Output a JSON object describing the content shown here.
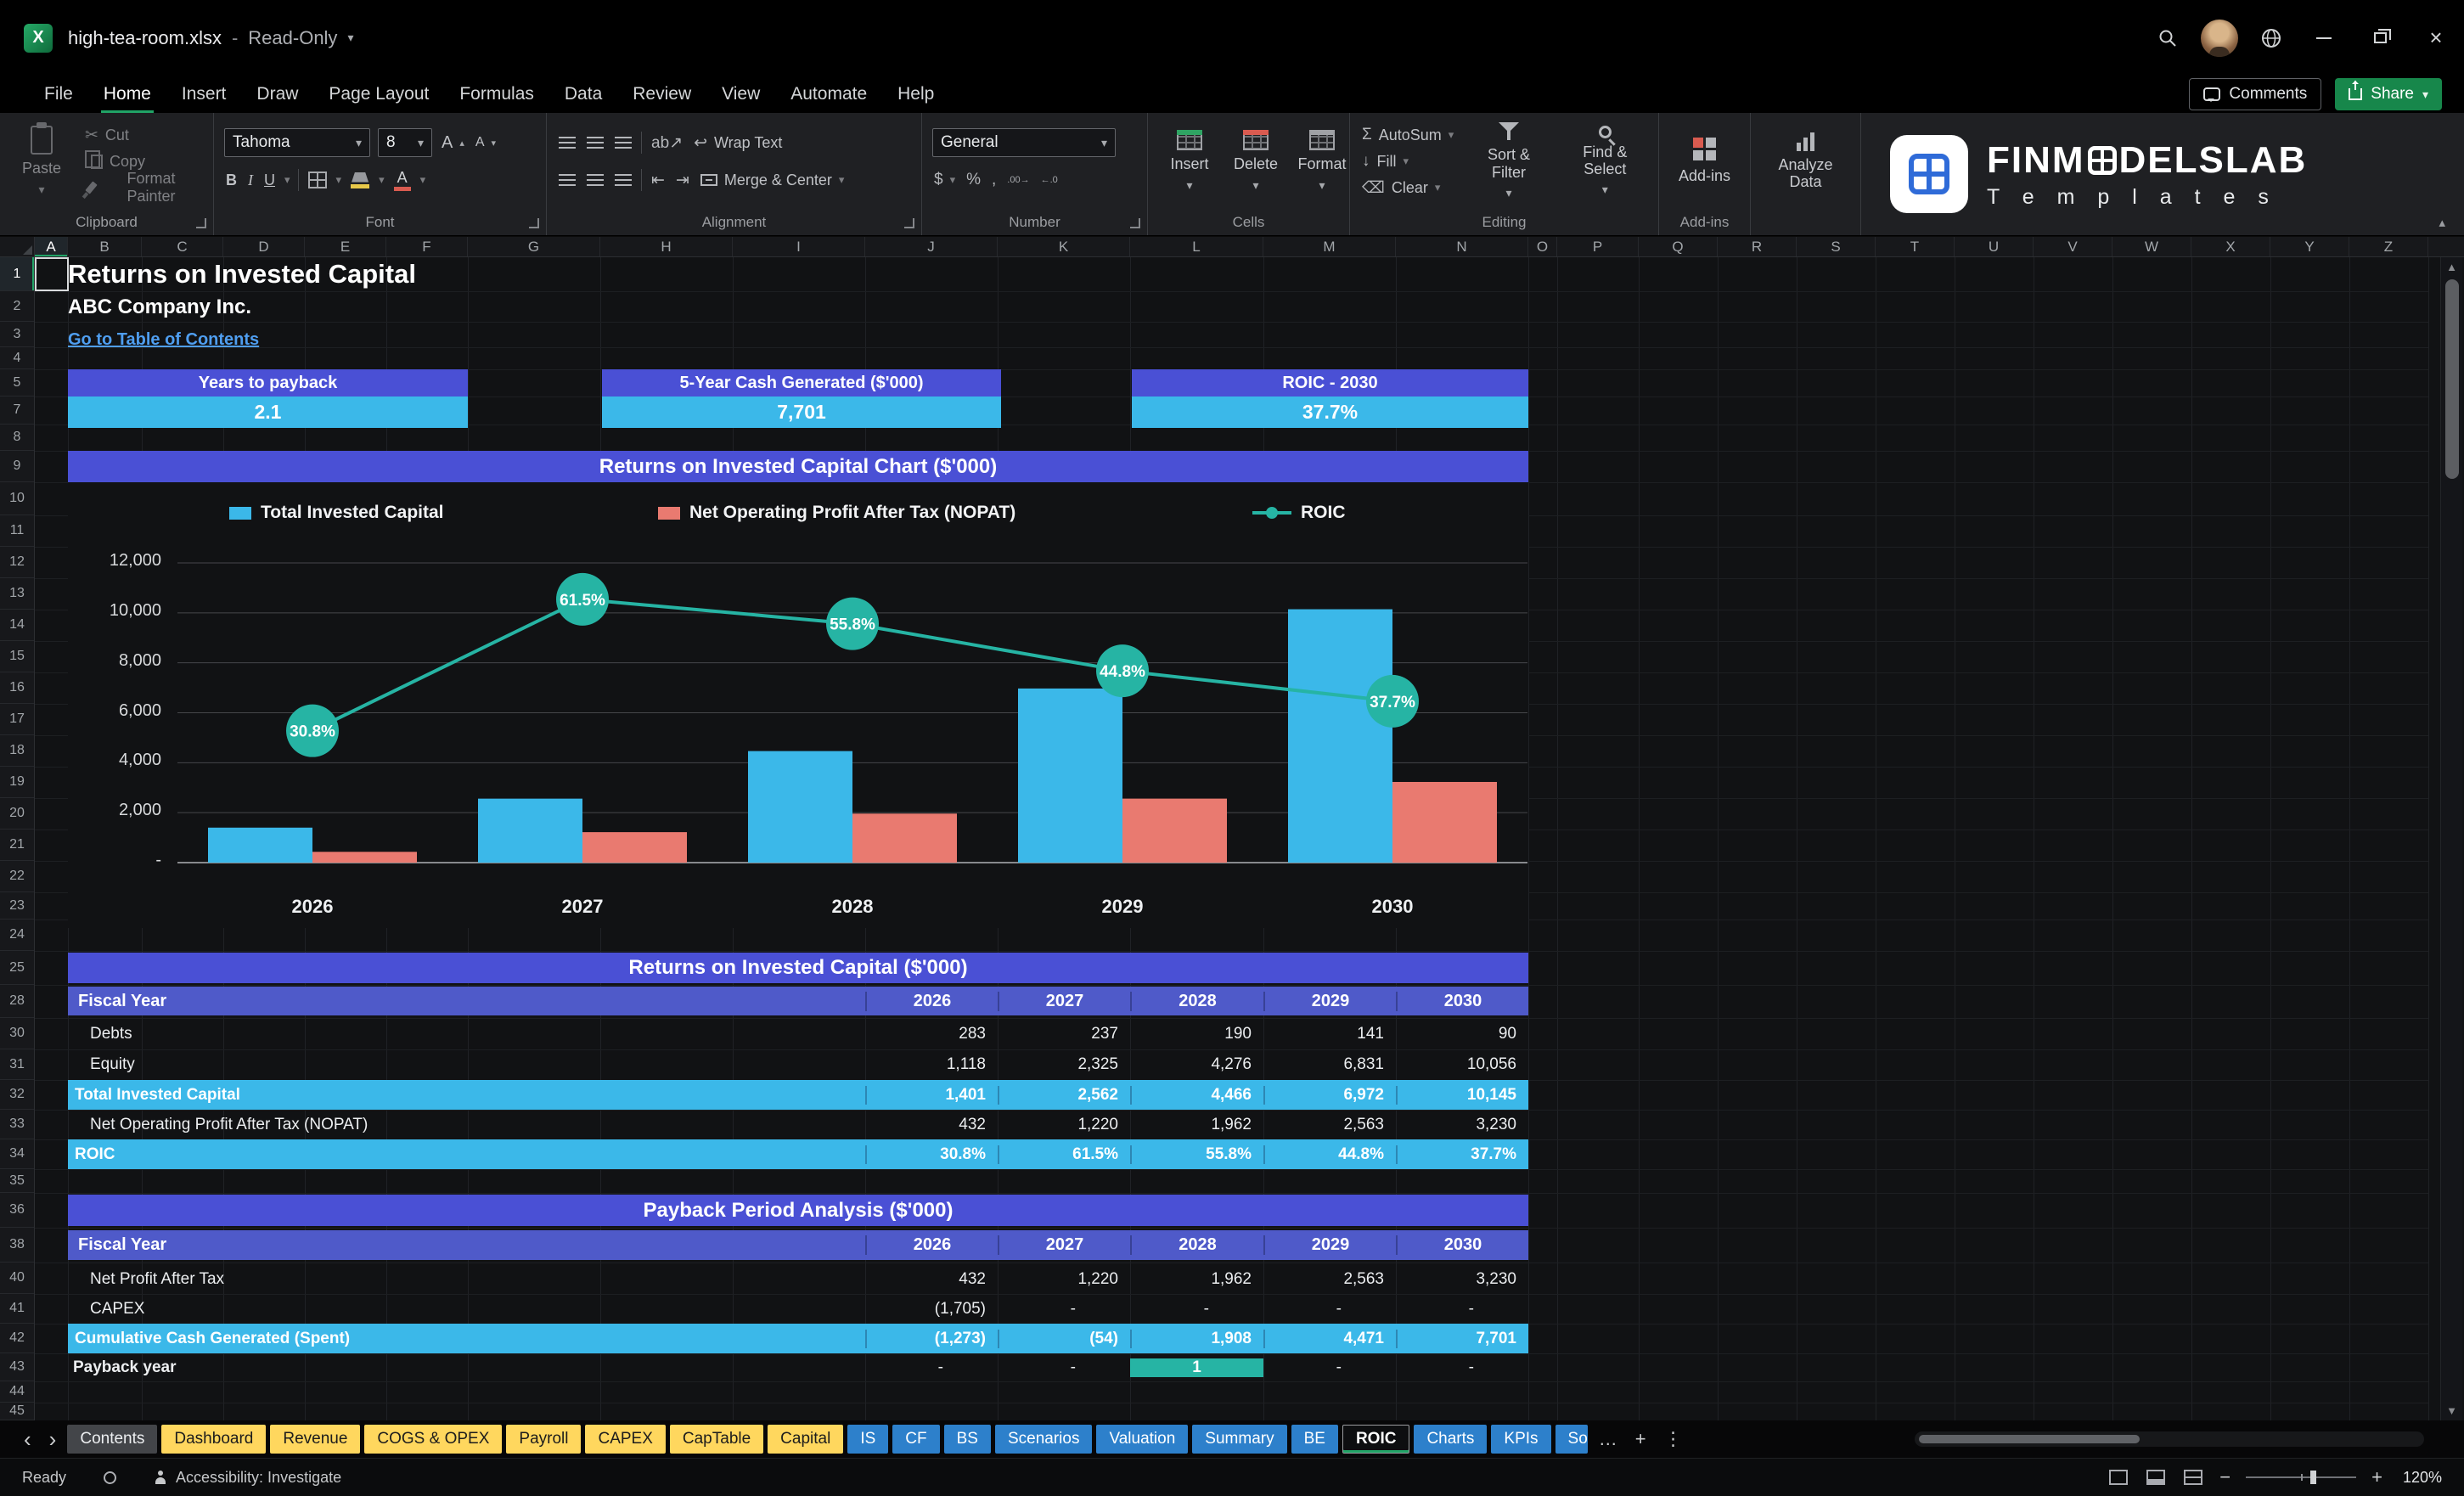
{
  "titlebar": {
    "filename": "high-tea-room.xlsx",
    "mode": "Read-Only"
  },
  "menubar": {
    "items": [
      "File",
      "Home",
      "Insert",
      "Draw",
      "Page Layout",
      "Formulas",
      "Data",
      "Review",
      "View",
      "Automate",
      "Help"
    ],
    "active_item": "Home",
    "comments_label": "Comments",
    "share_label": "Share"
  },
  "ribbon": {
    "clipboard": {
      "paste": "Paste",
      "cut": "Cut",
      "copy": "Copy",
      "format_painter": "Format Painter",
      "group_label": "Clipboard"
    },
    "font": {
      "font_name": "Tahoma",
      "font_size": "8",
      "bold": "B",
      "italic": "I",
      "underline": "U",
      "grow": "A",
      "shrink": "A",
      "color_letter": "A",
      "group_label": "Font"
    },
    "alignment": {
      "wrap_text": "Wrap Text",
      "merge_center": "Merge & Center",
      "group_label": "Alignment"
    },
    "number": {
      "format": "General",
      "group_label": "Number"
    },
    "cells": {
      "insert": "Insert",
      "delete": "Delete",
      "format": "Format",
      "group_label": "Cells"
    },
    "editing": {
      "autosum": "AutoSum",
      "fill": "Fill",
      "clear": "Clear",
      "sort_filter": "Sort & Filter",
      "find_select": "Find & Select",
      "group_label": "Editing"
    },
    "addins": {
      "label": "Add-ins",
      "group_label": "Add-ins"
    },
    "analyze": {
      "label": "Analyze Data"
    },
    "logo": {
      "brand_left": "FINM",
      "brand_right": "DELSLAB",
      "subtitle": "T e m p l a t e s"
    }
  },
  "icons": {
    "dropdown": "▾",
    "collapse": "▴",
    "cut": "✂",
    "autosum": "Σ",
    "fill": "↓",
    "clear": "⌫",
    "wrap": "↩",
    "orientation": "ab↗",
    "outdent": "⇤",
    "indent": "⇥",
    "accounting": "$",
    "percent": "%",
    "comma": ",",
    "increase_decimal": ".00→",
    "decrease_decimal": "←.0",
    "grow_caret": "▴",
    "shrink_caret": "▾",
    "close": "×",
    "tab_prev": "‹",
    "tab_next": "›",
    "tab_more": "…",
    "tab_add": "+",
    "tab_menu": "⋮"
  },
  "grid": {
    "columns": [
      "A",
      "B",
      "C",
      "D",
      "E",
      "F",
      "G",
      "H",
      "I",
      "J",
      "K",
      "L",
      "M",
      "N",
      "O",
      "P",
      "Q",
      "R",
      "S",
      "T",
      "U",
      "V",
      "W",
      "X",
      "Y",
      "Z"
    ],
    "rows": [
      "1",
      "2",
      "3",
      "4",
      "5",
      "7",
      "8",
      "9",
      "10",
      "11",
      "12",
      "13",
      "14",
      "15",
      "16",
      "17",
      "18",
      "19",
      "20",
      "21",
      "22",
      "23",
      "24",
      "25",
      "28",
      "30",
      "31",
      "32",
      "33",
      "34",
      "35",
      "36",
      "38",
      "40",
      "41",
      "42",
      "43",
      "44",
      "45"
    ]
  },
  "sheet": {
    "title": "Returns on Invested Capital",
    "subtitle": "ABC Company Inc.",
    "toc_link": "Go to Table of Contents",
    "kpis": [
      {
        "label": "Years to payback",
        "value": "2.1"
      },
      {
        "label": "5-Year Cash Generated ($'000)",
        "value": "7,701"
      },
      {
        "label": "ROIC - 2030",
        "value": "37.7%"
      }
    ],
    "roic_table": {
      "title": "Returns on Invested Capital ($'000)",
      "header": {
        "label": "Fiscal Year",
        "years": [
          "2026",
          "2027",
          "2028",
          "2029",
          "2030"
        ]
      },
      "rows": [
        {
          "label": "Debts",
          "values": [
            "283",
            "237",
            "190",
            "141",
            "90"
          ],
          "style": "plain"
        },
        {
          "label": "Equity",
          "values": [
            "1,118",
            "2,325",
            "4,276",
            "6,831",
            "10,056"
          ],
          "style": "plain"
        },
        {
          "label": "Total Invested Capital",
          "values": [
            "1,401",
            "2,562",
            "4,466",
            "6,972",
            "10,145"
          ],
          "style": "hl"
        },
        {
          "label": "Net Operating Profit After Tax (NOPAT)",
          "values": [
            "432",
            "1,220",
            "1,962",
            "2,563",
            "3,230"
          ],
          "style": "plain"
        },
        {
          "label": "ROIC",
          "values": [
            "30.8%",
            "61.5%",
            "55.8%",
            "44.8%",
            "37.7%"
          ],
          "style": "hl"
        }
      ]
    },
    "payback_table": {
      "title": "Payback Period Analysis ($'000)",
      "header": {
        "label": "Fiscal Year",
        "years": [
          "2026",
          "2027",
          "2028",
          "2029",
          "2030"
        ]
      },
      "rows": [
        {
          "label": "Net Profit After Tax",
          "values": [
            "432",
            "1,220",
            "1,962",
            "2,563",
            "3,230"
          ],
          "style": "plain"
        },
        {
          "label": "CAPEX",
          "values": [
            "(1,705)",
            "-",
            "-",
            "-",
            "-"
          ],
          "style": "plain"
        },
        {
          "label": "Cumulative Cash Generated (Spent)",
          "values": [
            "(1,273)",
            "(54)",
            "1,908",
            "4,471",
            "7,701"
          ],
          "style": "hl"
        },
        {
          "label": "Payback year",
          "values": [
            "-",
            "-",
            "1",
            "-",
            "-"
          ],
          "style": "payback"
        }
      ]
    }
  },
  "chart_data": {
    "type": "bar",
    "subtype": "combo-bar-line",
    "title": "Returns on Invested Capital Chart ($'000)",
    "categories": [
      "2026",
      "2027",
      "2028",
      "2029",
      "2030"
    ],
    "series": [
      {
        "name": "Total Invested Capital",
        "type": "bar",
        "color": "#3bb8e9",
        "values": [
          1401,
          2562,
          4466,
          6972,
          10145
        ]
      },
      {
        "name": "Net Operating Profit After Tax (NOPAT)",
        "type": "bar",
        "color": "#e97a70",
        "values": [
          432,
          1220,
          1962,
          2563,
          3230
        ]
      },
      {
        "name": "ROIC",
        "type": "line",
        "axis": "secondary",
        "color": "#26b4a4",
        "values": [
          30.8,
          61.5,
          55.8,
          44.8,
          37.7
        ],
        "labels": [
          "30.8%",
          "61.5%",
          "55.8%",
          "44.8%",
          "37.7%"
        ]
      }
    ],
    "y_ticks": [
      "12,000",
      "10,000",
      "8,000",
      "6,000",
      "4,000",
      "2,000",
      "-"
    ],
    "ylim": [
      0,
      12000
    ],
    "y2lim": [
      0,
      70
    ],
    "legend_position": "top",
    "grid": true
  },
  "tabs": {
    "items": [
      {
        "label": "Contents",
        "style": "gray"
      },
      {
        "label": "Dashboard",
        "style": "yellow"
      },
      {
        "label": "Revenue",
        "style": "yellow"
      },
      {
        "label": "COGS & OPEX",
        "style": "yellow"
      },
      {
        "label": "Payroll",
        "style": "yellow"
      },
      {
        "label": "CAPEX",
        "style": "yellow"
      },
      {
        "label": "CapTable",
        "style": "yellow"
      },
      {
        "label": "Capital",
        "style": "yellow"
      },
      {
        "label": "IS",
        "style": "blue"
      },
      {
        "label": "CF",
        "style": "blue"
      },
      {
        "label": "BS",
        "style": "blue"
      },
      {
        "label": "Scenarios",
        "style": "blue"
      },
      {
        "label": "Valuation",
        "style": "blue"
      },
      {
        "label": "Summary",
        "style": "blue"
      },
      {
        "label": "BE",
        "style": "blue"
      },
      {
        "label": "ROIC",
        "style": "active"
      },
      {
        "label": "Charts",
        "style": "blue"
      },
      {
        "label": "KPIs",
        "style": "blue"
      },
      {
        "label": "So",
        "style": "blue",
        "clipped": true
      }
    ]
  },
  "statusbar": {
    "ready": "Ready",
    "accessibility": "Accessibility: Investigate",
    "zoom": "120%",
    "zoom_out": "−",
    "zoom_in": "+"
  },
  "colors": {
    "banner": "#4a50d5",
    "table_header": "#4f5ac9",
    "highlight": "#3bb8e9",
    "bar_blue": "#3bb8e9",
    "bar_salmon": "#e97a70",
    "teal": "#26b4a4",
    "tab_yellow": "#ffd75e",
    "tab_blue": "#2d80cb",
    "accent_green": "#21a366",
    "link": "#4f9ef0"
  }
}
